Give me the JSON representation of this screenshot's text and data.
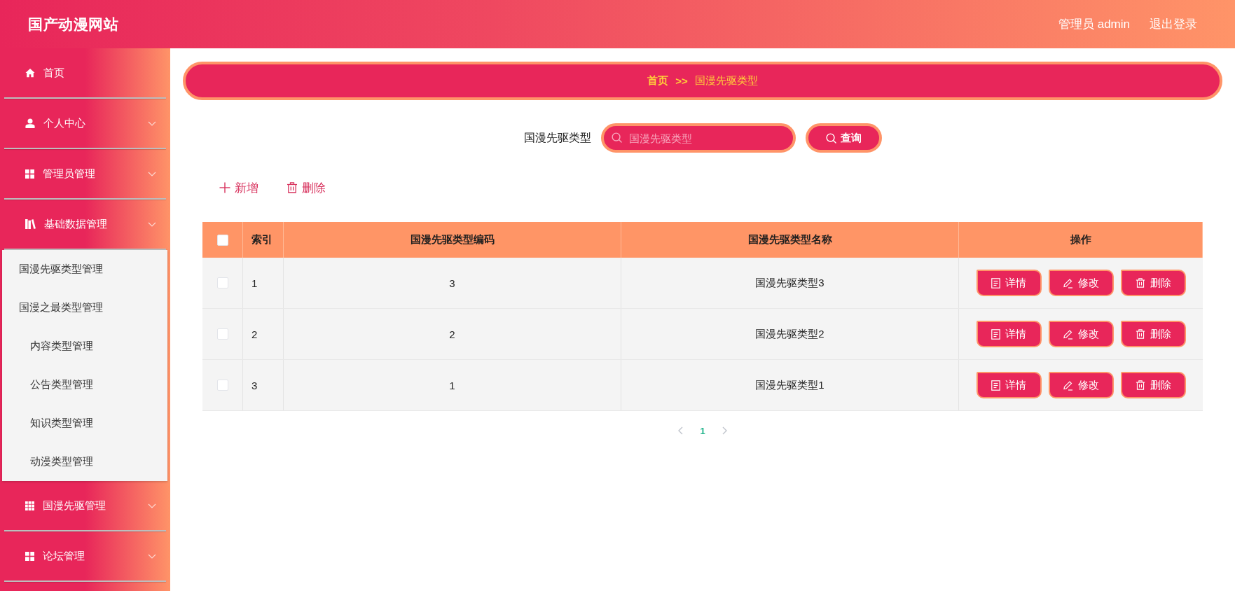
{
  "header": {
    "title": "国产动漫网站",
    "user": "管理员 admin",
    "logout": "退出登录"
  },
  "sidebar": {
    "items": [
      {
        "label": "首页",
        "kind": "link"
      },
      {
        "label": "个人中心",
        "kind": "menu"
      },
      {
        "label": "管理员管理",
        "kind": "menu"
      },
      {
        "label": "基础数据管理",
        "kind": "menu",
        "children": [
          {
            "label": "国漫先驱类型管理"
          },
          {
            "label": "国漫之最类型管理",
            "children": [
              {
                "label": "内容类型管理"
              },
              {
                "label": "公告类型管理"
              },
              {
                "label": "知识类型管理"
              },
              {
                "label": "动漫类型管理"
              }
            ]
          }
        ]
      },
      {
        "label": "国漫先驱管理",
        "kind": "menu"
      },
      {
        "label": "论坛管理",
        "kind": "menu"
      }
    ]
  },
  "breadcrumb": {
    "home": "首页",
    "separator": ">>",
    "current": "国漫先驱类型"
  },
  "search": {
    "label": "国漫先驱类型",
    "placeholder": "国漫先驱类型",
    "button": "查询"
  },
  "toolbar": [
    {
      "label": "新增",
      "kind": "add"
    },
    {
      "label": "删除",
      "kind": "delete"
    }
  ],
  "table": {
    "select_all": {
      "checked": false
    },
    "columns": [
      "索引",
      "国漫先驱类型编码",
      "国漫先驱类型名称",
      "操作"
    ],
    "rows": [
      {
        "checked": false,
        "cells": [
          "1",
          "3",
          "国漫先驱类型3"
        ],
        "actions": [
          {
            "label": "详情",
            "kind": "detail"
          },
          {
            "label": "修改",
            "kind": "edit"
          },
          {
            "label": "删除",
            "kind": "delete"
          }
        ]
      },
      {
        "checked": false,
        "cells": [
          "2",
          "2",
          "国漫先驱类型2"
        ],
        "actions": [
          {
            "label": "详情",
            "kind": "detail"
          },
          {
            "label": "修改",
            "kind": "edit"
          },
          {
            "label": "删除",
            "kind": "delete"
          }
        ]
      },
      {
        "checked": false,
        "cells": [
          "3",
          "1",
          "国漫先驱类型1"
        ],
        "actions": [
          {
            "label": "详情",
            "kind": "detail"
          },
          {
            "label": "修改",
            "kind": "edit"
          },
          {
            "label": "删除",
            "kind": "delete"
          }
        ]
      }
    ]
  },
  "pagination": {
    "pages": [
      {
        "label": "1",
        "selected": true
      }
    ]
  }
}
